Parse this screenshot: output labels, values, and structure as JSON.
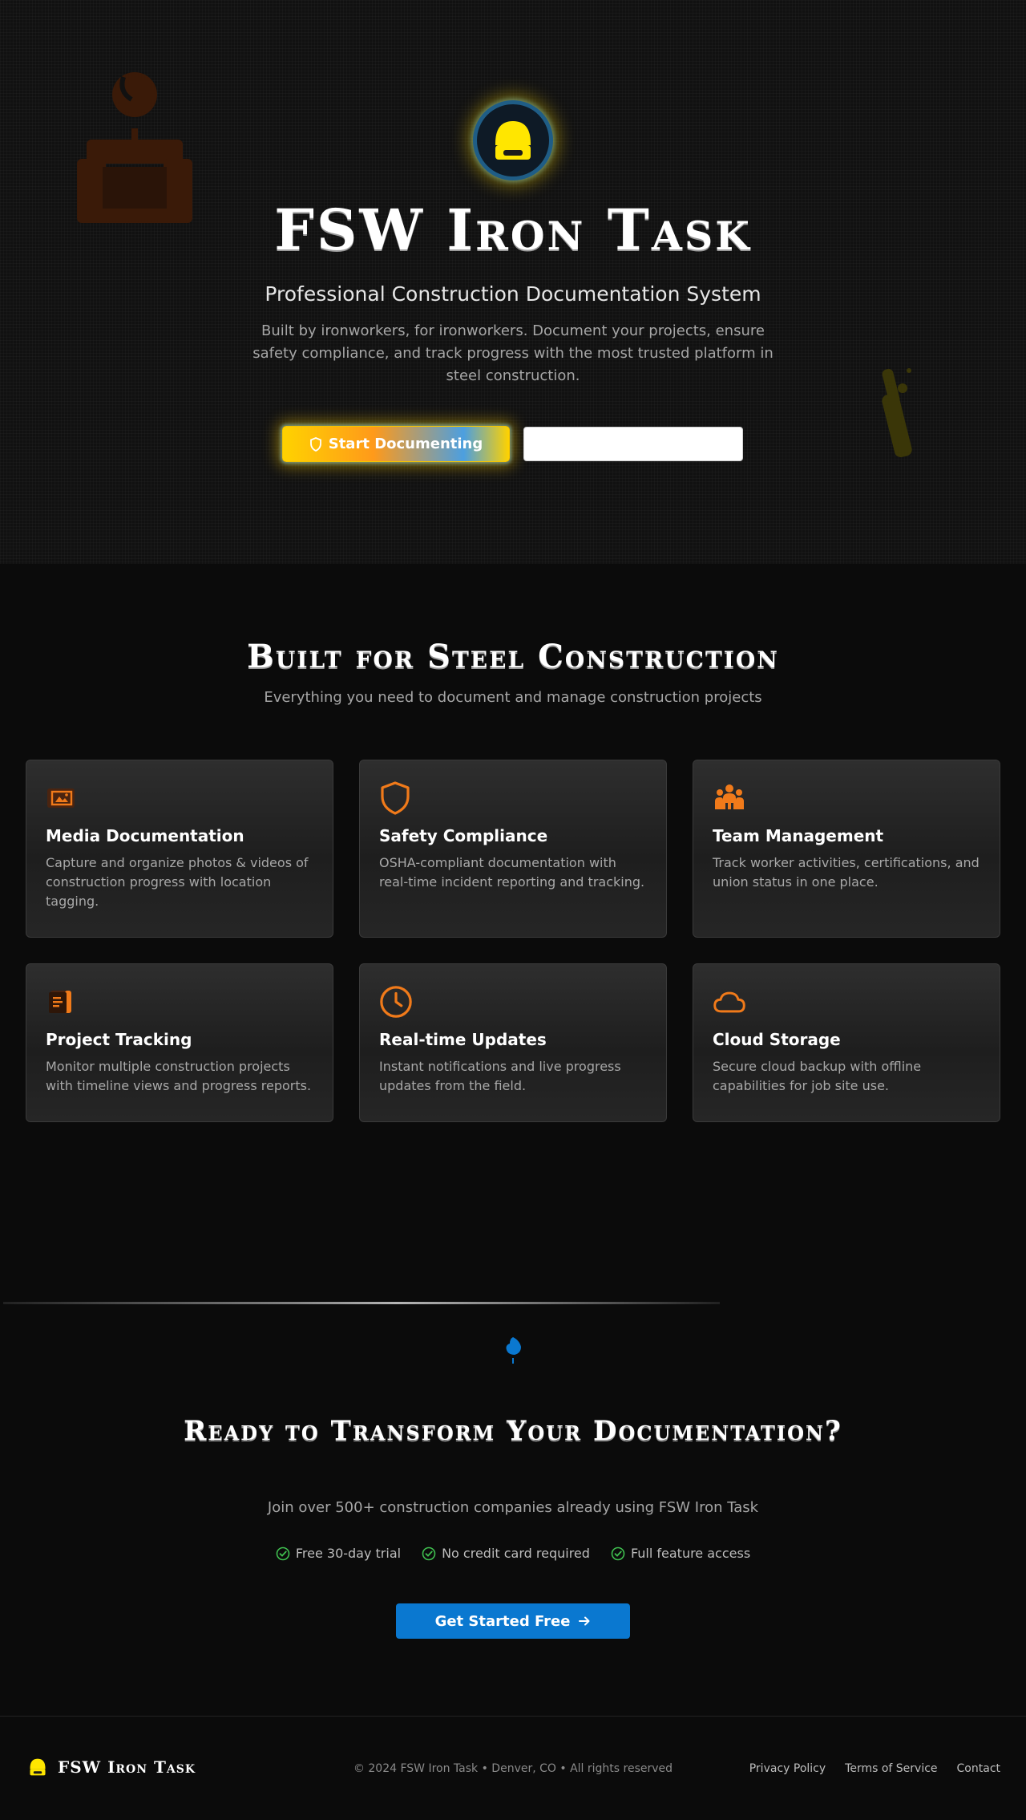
{
  "hero": {
    "title": "FSW Iron Task",
    "subtitle": "Professional Construction Documentation System",
    "description": "Built by ironworkers, for ironworkers. Document your projects, ensure safety compliance, and track progress with the most trusted platform in steel construction.",
    "start_button": "Start Documenting",
    "secondary_button": ""
  },
  "features": {
    "title": "Built for Steel Construction",
    "subtitle": "Everything you need to document and manage construction projects",
    "cards": [
      {
        "icon": "media-icon",
        "title": "Media Documentation",
        "description": "Capture and organize photos & videos of construction progress with location tagging."
      },
      {
        "icon": "shield-icon",
        "title": "Safety Compliance",
        "description": "OSHA-compliant documentation with real-time incident reporting and tracking."
      },
      {
        "icon": "team-icon",
        "title": "Team Management",
        "description": "Track worker activities, certifications, and union status in one place."
      },
      {
        "icon": "clipboard-icon",
        "title": "Project Tracking",
        "description": "Monitor multiple construction projects with timeline views and progress reports."
      },
      {
        "icon": "clock-icon",
        "title": "Real-time Updates",
        "description": "Instant notifications and live progress updates from the field."
      },
      {
        "icon": "cloud-icon",
        "title": "Cloud Storage",
        "description": "Secure cloud backup with offline capabilities for job site use."
      }
    ]
  },
  "cta": {
    "title": "Ready to Transform Your Documentation?",
    "subtitle": "Join over 500+ construction companies already using FSW Iron Task",
    "checks": [
      "Free 30-day trial",
      "No credit card required",
      "Full feature access"
    ],
    "button": "Get Started Free"
  },
  "footer": {
    "brand": "FSW Iron Task",
    "copyright": "© 2024 FSW Iron Task • Denver, CO • All rights reserved",
    "links": [
      "Privacy Policy",
      "Terms of Service",
      "Contact"
    ]
  },
  "colors": {
    "accent_orange": "#f07a1a",
    "accent_yellow": "#ffe600",
    "accent_blue": "#0a78d0",
    "check_green": "#3fbf4f",
    "background": "#0b0b0b"
  }
}
